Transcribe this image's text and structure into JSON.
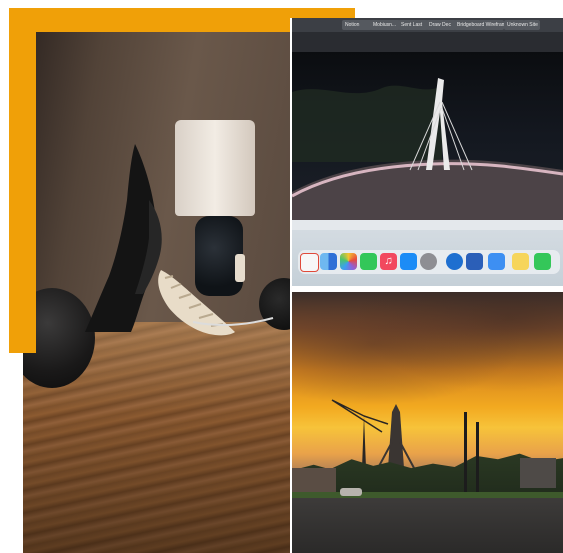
{
  "layout": {
    "frame_color": "#f0a008"
  },
  "browser_tabs": [
    "Notion",
    "Mobiusn...",
    "Sent Last",
    "Draw Dec",
    "Bridgeboard Wireframe Sunset",
    "Unknown Site"
  ],
  "icons": [
    "calendar-icon",
    "finder-icon",
    "photos-icon",
    "facetime-icon",
    "music-icon",
    "app-store-icon",
    "settings-icon",
    "quicktime-icon",
    "word-icon",
    "s-app-icon",
    "notes-icon",
    "messages-icon"
  ]
}
